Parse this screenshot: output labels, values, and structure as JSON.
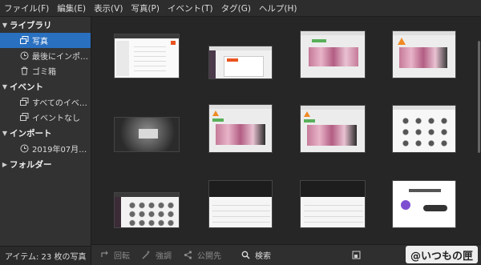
{
  "menu": [
    "ファイル(F)",
    "編集(E)",
    "表示(V)",
    "写真(P)",
    "イベント(T)",
    "タグ(G)",
    "ヘルプ(H)"
  ],
  "sidebar": {
    "library": {
      "title": "ライブラリ",
      "items": [
        {
          "label": "写真",
          "icon": "photos-icon",
          "selected": true
        },
        {
          "label": "最後にインポ…",
          "icon": "last-import-icon",
          "selected": false
        },
        {
          "label": "ゴミ箱",
          "icon": "trash-icon",
          "selected": false
        }
      ]
    },
    "events": {
      "title": "イベント",
      "items": [
        {
          "label": "すべてのイベ…",
          "icon": "all-events-icon"
        },
        {
          "label": "イベントなし",
          "icon": "no-event-icon"
        }
      ]
    },
    "imports": {
      "title": "インポート",
      "items": [
        {
          "label": "2019年07月1…",
          "icon": "clock-icon"
        }
      ]
    },
    "folders": {
      "title": "フォルダー"
    }
  },
  "status": "アイテム:  23 枚の写真",
  "toolbar": {
    "rotate": "回転",
    "enhance": "強調",
    "publish": "公開先",
    "search": "検索"
  },
  "watermark": "@いつもの匣",
  "colors": {
    "selection": "#2a70c0",
    "orange_accent": "#e95420",
    "pink_image": "#d38aa8",
    "green_bar": "#59b05a"
  }
}
